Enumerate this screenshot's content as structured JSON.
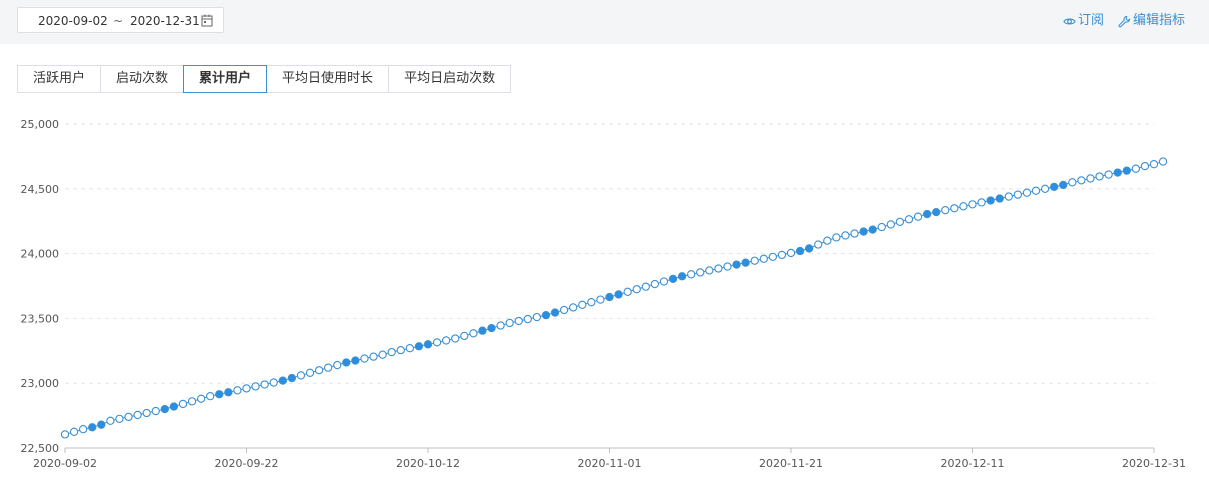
{
  "toolbar": {
    "date_start": "2020-09-02",
    "date_separator": "~",
    "date_end": "2020-12-31",
    "subscribe_label": "订阅",
    "edit_metrics_label": "编辑指标",
    "accent_color": "#3b8fd3"
  },
  "tabs": [
    {
      "label": "活跃用户",
      "active": false
    },
    {
      "label": "启动次数",
      "active": false
    },
    {
      "label": "累计用户",
      "active": true
    },
    {
      "label": "平均日使用时长",
      "active": false
    },
    {
      "label": "平均日启动次数",
      "active": false
    }
  ],
  "chart_data": {
    "type": "line",
    "x_start": "2020-09-02",
    "x_end": "2020-12-31",
    "x_ticks": [
      "2020-09-02",
      "2020-09-22",
      "2020-10-12",
      "2020-11-01",
      "2020-11-21",
      "2020-12-11",
      "2020-12-31"
    ],
    "y_ticks": [
      "22,500",
      "23,000",
      "23,500",
      "24,000",
      "24,500",
      "25,000"
    ],
    "ylim": [
      22500,
      25000
    ],
    "grid": true,
    "series": [
      {
        "values": [
          22605,
          22625,
          22645,
          22660,
          22680,
          22710,
          22725,
          22740,
          22755,
          22770,
          22785,
          22800,
          22820,
          22840,
          22860,
          22880,
          22900,
          22915,
          22930,
          22945,
          22960,
          22975,
          22990,
          23005,
          23020,
          23040,
          23060,
          23080,
          23100,
          23120,
          23140,
          23160,
          23175,
          23190,
          23205,
          23220,
          23240,
          23255,
          23270,
          23285,
          23300,
          23315,
          23330,
          23345,
          23365,
          23385,
          23405,
          23425,
          23445,
          23465,
          23480,
          23495,
          23510,
          23525,
          23545,
          23565,
          23585,
          23605,
          23625,
          23645,
          23665,
          23685,
          23705,
          23725,
          23745,
          23765,
          23785,
          23805,
          23825,
          23840,
          23855,
          23870,
          23885,
          23900,
          23915,
          23930,
          23945,
          23960,
          23975,
          23990,
          24005,
          24020,
          24040,
          24070,
          24100,
          24125,
          24140,
          24155,
          24170,
          24185,
          24205,
          24225,
          24245,
          24265,
          24285,
          24305,
          24320,
          24335,
          24350,
          24365,
          24380,
          24395,
          24410,
          24425,
          24440,
          24455,
          24470,
          24485,
          24500,
          24515,
          24530,
          24550,
          24565,
          24580,
          24595,
          24610,
          24625,
          24640,
          24655,
          24675,
          24690,
          24710
        ],
        "filled_indices": [
          3,
          4,
          11,
          12,
          17,
          18,
          24,
          25,
          31,
          32,
          39,
          40,
          46,
          47,
          53,
          54,
          60,
          61,
          67,
          68,
          74,
          75,
          81,
          82,
          88,
          89,
          95,
          96,
          102,
          103,
          109,
          110,
          116,
          117
        ],
        "color": "#3b8fd3",
        "filled_color": "#2a8fe0"
      }
    ]
  }
}
